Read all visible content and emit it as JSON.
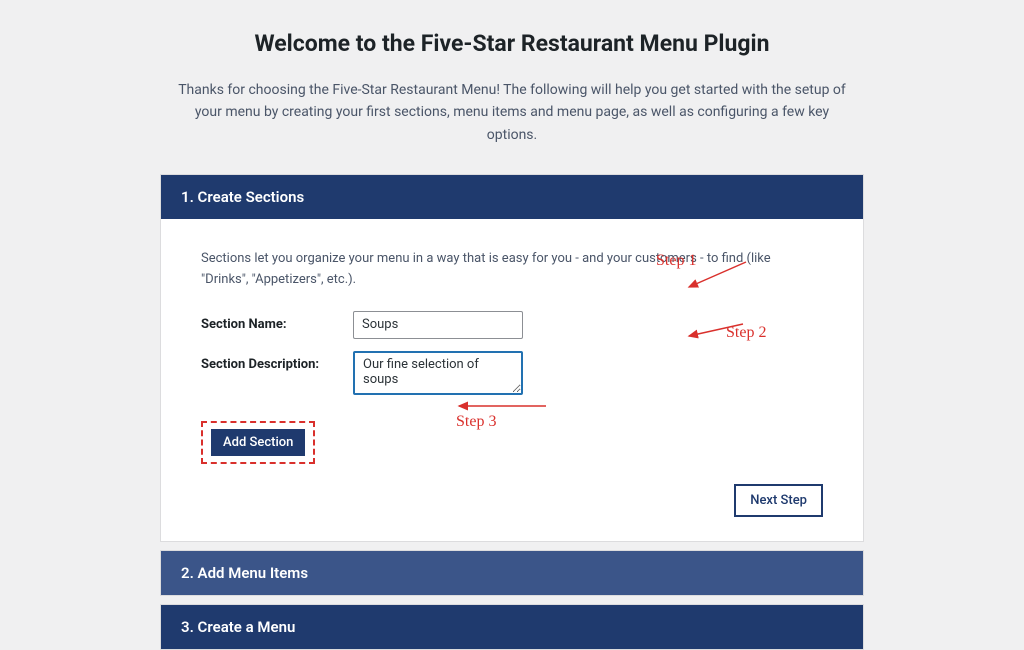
{
  "header": {
    "title": "Welcome to the Five-Star Restaurant Menu Plugin",
    "intro": "Thanks for choosing the Five-Star Restaurant Menu! The following will help you get started with the setup of your menu by creating your first sections, menu items and menu page, as well as configuring a few key options."
  },
  "step1": {
    "panel_title": "1. Create Sections",
    "description": "Sections let you organize your menu in a way that is easy for you - and your customers - to find (like \"Drinks\", \"Appetizers\", etc.).",
    "name_label": "Section Name:",
    "name_value": "Soups",
    "desc_label": "Section Description:",
    "desc_value": "Our fine selection of soups",
    "add_button": "Add Section",
    "next_button": "Next Step"
  },
  "step2": {
    "panel_title": "2. Add Menu Items"
  },
  "step3": {
    "panel_title": "3. Create a Menu"
  },
  "annotations": {
    "step1": "Step 1",
    "step2": "Step 2",
    "step3": "Step 3"
  },
  "colors": {
    "panel_dark": "#1f3a6e",
    "panel_light": "#3b5589",
    "annotation_red": "#d9302c",
    "focus_blue": "#2271b1"
  }
}
